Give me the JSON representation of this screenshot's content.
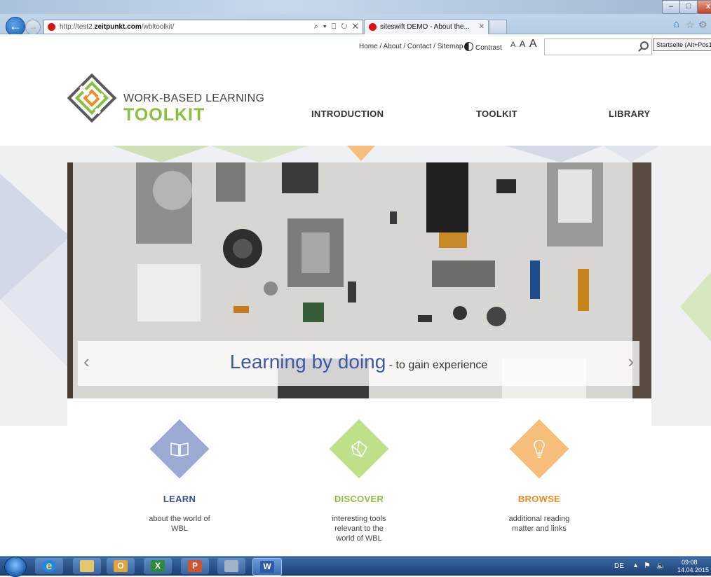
{
  "browser": {
    "url_prefix": "http://test2.",
    "url_domain": "zeitpunkt.com",
    "url_path": "/wbltoolkit/",
    "addr_controls": "⌕ ▾ ⎕ ↻ ✕",
    "tab_title": "siteswift DEMO - About the...",
    "tab_close": "✕",
    "back_glyph": "←",
    "forward_glyph": "→",
    "win_min": "–",
    "win_max": "□",
    "win_close": "x"
  },
  "header": {
    "util_links": "Home / About / Contact / Sitemap",
    "contrast_label": "Contrast",
    "textsize": [
      "A",
      "A",
      "A"
    ],
    "tooltip": "Startseite (Alt+Pos1)"
  },
  "logo": {
    "line1": "WORK-BASED LEARNING",
    "line2": "TOOLKIT"
  },
  "nav": {
    "introduction": "INTRODUCTION",
    "toolkit": "TOOLKIT",
    "library": "LIBRARY"
  },
  "hero": {
    "caption_main": "Learning by doing",
    "caption_sub": " - to gain experience",
    "prev": "‹",
    "next": "›"
  },
  "features": [
    {
      "title": "LEARN",
      "text": "about the world of WBL",
      "color": "#9aaad3",
      "title_color": "#3c4f8f",
      "icon": "book-icon",
      "glyph": "🕮"
    },
    {
      "title": "DISCOVER",
      "text": "interesting tools relevant to the world of WBL",
      "color": "#bfe08b",
      "title_color": "#8cbf3f",
      "icon": "cube-icon",
      "glyph": "⬡"
    },
    {
      "title": "BROWSE",
      "text": "additional reading matter and links",
      "color": "#f7bd7b",
      "title_color": "#f08a24",
      "icon": "lightbulb-icon",
      "glyph": "💡"
    }
  ],
  "taskbar": {
    "lang": "DE",
    "time": "09:08",
    "date": "14.04.2015",
    "outlook_glyph": "O",
    "excel_glyph": "X",
    "ppt_glyph": "P",
    "word_glyph": "W",
    "ie_glyph": "e"
  },
  "colors": {
    "brand_green": "#8cbf3f",
    "brand_blue": "#3e5aa6",
    "brand_orange": "#f08a24"
  }
}
